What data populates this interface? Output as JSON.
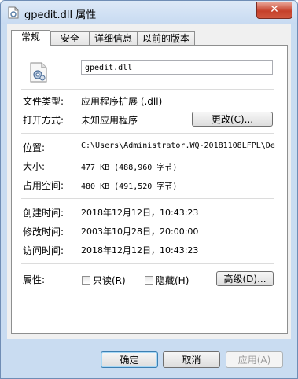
{
  "window": {
    "title": "gpedit.dll 属性",
    "close_glyph": "✕"
  },
  "tabs": [
    {
      "label": "常规",
      "active": true
    },
    {
      "label": "安全",
      "active": false
    },
    {
      "label": "详细信息",
      "active": false
    },
    {
      "label": "以前的版本",
      "active": false
    }
  ],
  "general": {
    "file_name": "gpedit.dll",
    "file_type_label": "文件类型:",
    "file_type_value": "应用程序扩展 (.dll)",
    "open_with_label": "打开方式:",
    "open_with_value": "未知应用程序",
    "change_button": "更改(C)...",
    "location_label": "位置:",
    "location_value": "C:\\Users\\Administrator.WQ-20181108LFPL\\De",
    "size_label": "大小:",
    "size_value": "477 KB (488,960 字节)",
    "size_on_disk_label": "占用空间:",
    "size_on_disk_value": "480 KB (491,520 字节)",
    "created_label": "创建时间:",
    "created_value": "2018年12月12日，10:43:23",
    "modified_label": "修改时间:",
    "modified_value": "2003年10月28日，20:00:00",
    "accessed_label": "访问时间:",
    "accessed_value": "2018年12月12日，10:43:23",
    "attributes_label": "属性:",
    "readonly_label": "只读(R)",
    "readonly_checked": false,
    "hidden_label": "隐藏(H)",
    "hidden_checked": false,
    "advanced_button": "高级(D)..."
  },
  "footer": {
    "ok_button": "确定",
    "cancel_button": "取消",
    "apply_button": "应用(A)"
  },
  "colors": {
    "frame": "#c9dcf1",
    "close_button": "#c5402a",
    "default_button_border": "#3c7fb1"
  }
}
